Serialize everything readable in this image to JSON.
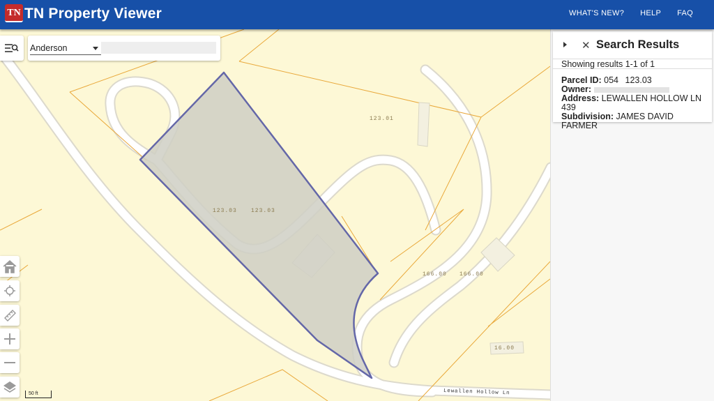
{
  "header": {
    "logo_text": "TN",
    "app_title": "TN Property Viewer",
    "nav": [
      "WHAT'S NEW?",
      "HELP",
      "FAQ"
    ]
  },
  "search": {
    "county": "Anderson",
    "input_value": ""
  },
  "map": {
    "parcel_labels": [
      "123.01",
      "123.03",
      "123.03",
      "166.00",
      "166.00",
      "16.00"
    ],
    "road_label": "Lewallen Hollow Ln",
    "scale_label": "50 ft",
    "tools": [
      "home-icon",
      "locate-icon",
      "measure-icon",
      "zoom-in-icon",
      "zoom-out-icon",
      "layers-icon"
    ],
    "colors": {
      "background": "#fdf8d6",
      "parcel_line": "#e9a83a",
      "selected_fill": "#d7d6c6",
      "selected_stroke": "#6467a8",
      "road": "#ffffff"
    }
  },
  "results": {
    "title": "Search Results",
    "showing": "Showing results 1-1 of 1",
    "parcel_id_label": "Parcel ID:",
    "parcel_id_value": "054",
    "parcel_id_suffix": "123.03",
    "owner_label": "Owner:",
    "address_label": "Address:",
    "address_value": "LEWALLEN HOLLOW LN 439",
    "subdivision_label": "Subdivision:",
    "subdivision_value": "JAMES DAVID FARMER"
  }
}
